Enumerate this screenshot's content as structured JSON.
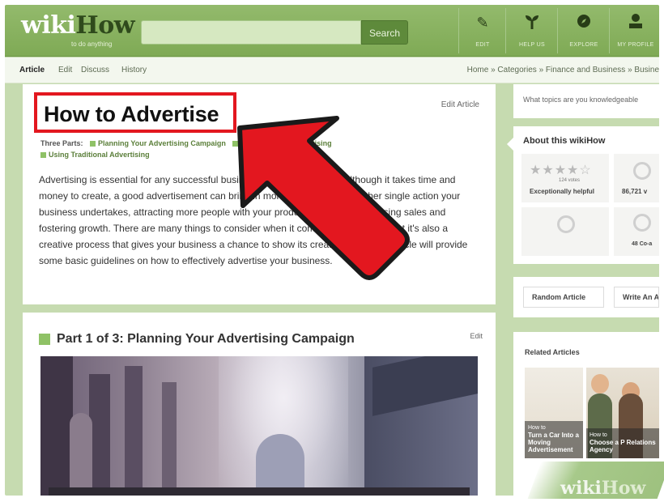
{
  "brand": {
    "logo_main": "wiki",
    "logo_accent": "How",
    "tagline": "to do anything",
    "watermark_main": "wiki",
    "watermark_accent": "How"
  },
  "search": {
    "placeholder": "",
    "button_label": "Search"
  },
  "nav": [
    {
      "label": "EDIT",
      "icon": "pencil-icon"
    },
    {
      "label": "HELP US",
      "icon": "sprout-icon"
    },
    {
      "label": "EXPLORE",
      "icon": "compass-icon"
    },
    {
      "label": "MY PROFILE",
      "icon": "user-icon"
    }
  ],
  "tabs": [
    "Article",
    "Edit",
    "Discuss",
    "History"
  ],
  "breadcrumb": "Home » Categories » Finance and Business » Busine",
  "article": {
    "title": "How to Advertise",
    "edit_label": "Edit Article",
    "parts_prefix": "Three Parts:",
    "parts": [
      "Planning Your Advertising Campaign",
      "Using Internet Advertising",
      "Using Traditional Advertising"
    ],
    "intro": "Advertising is essential for any successful business to grow effectively. Although it takes time and money to create, a good advertisement can bring in more money than any other single action your business undertakes, attracting more people with your product or service, increasing sales and fostering growth. There are many things to consider when it comes to advertising, but it's also a creative process that gives your business a chance to show its creative side! This article will provide some basic guidelines on how to effectively advertise your business."
  },
  "part1": {
    "title": "Part 1 of 3: Planning Your Advertising Campaign",
    "edit_label": "Edit"
  },
  "sidebar": {
    "topics_prompt": "What topics are you knowledgeable",
    "about_heading": "About this wikiHow",
    "votes": "124 votes",
    "rating_label": "Exceptionally helpful",
    "rating_stars": 4.5,
    "views": "86,721 v",
    "coauthors": "48 Co-a",
    "random_article": "Random Article",
    "write_article": "Write An A",
    "related_heading": "Related Articles",
    "related": [
      {
        "prefix": "How to",
        "title": "Turn a Car Into a Moving Advertisement"
      },
      {
        "prefix": "How to",
        "title": "Choose a P Relations Agency"
      }
    ]
  },
  "colors": {
    "brand_green": "#7faa55",
    "highlight_red": "#e3171f",
    "accent_square": "#8fc266"
  }
}
